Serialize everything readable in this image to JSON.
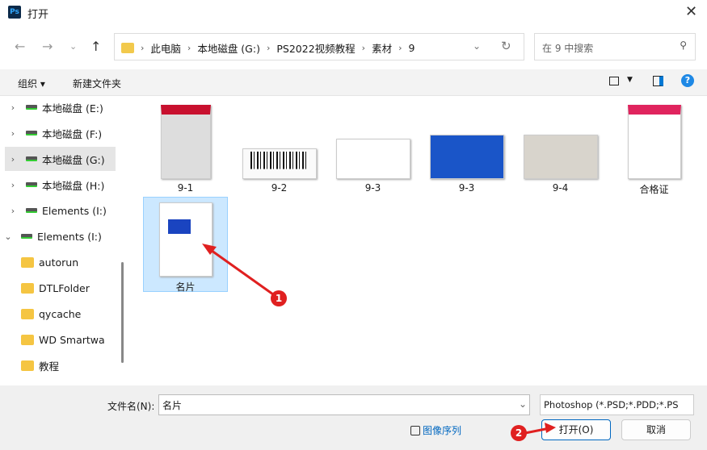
{
  "window": {
    "app_icon": "Ps",
    "title": "打开"
  },
  "address": {
    "crumbs": [
      "此电脑",
      "本地磁盘 (G:)",
      "PS2022视频教程",
      "素材",
      "9"
    ]
  },
  "search": {
    "placeholder": "在 9 中搜索"
  },
  "toolbar": {
    "organize": "组织 ▾",
    "new_folder": "新建文件夹"
  },
  "sidebar": {
    "items": [
      {
        "label": "本地磁盘 (E:)",
        "type": "drive"
      },
      {
        "label": "本地磁盘 (F:)",
        "type": "drive"
      },
      {
        "label": "本地磁盘 (G:)",
        "type": "drive",
        "selected": true
      },
      {
        "label": "本地磁盘 (H:)",
        "type": "drive"
      },
      {
        "label": "Elements (I:)",
        "type": "drive"
      },
      {
        "label": "Elements (I:)",
        "type": "drive",
        "expanded": true
      },
      {
        "label": "autorun",
        "type": "folder"
      },
      {
        "label": "DTLFolder",
        "type": "folder"
      },
      {
        "label": "qycache",
        "type": "folder"
      },
      {
        "label": "WD Smartwa",
        "type": "folder"
      },
      {
        "label": "教程",
        "type": "folder"
      }
    ]
  },
  "files": [
    {
      "name": "9-1"
    },
    {
      "name": "9-2"
    },
    {
      "name": "9-3"
    },
    {
      "name": "9-3"
    },
    {
      "name": "9-4"
    },
    {
      "name": "合格证"
    },
    {
      "name": "名片",
      "selected": true
    }
  ],
  "bottom": {
    "filename_label": "文件名(N):",
    "filename_value": "名片",
    "filetype": "Photoshop (*.PSD;*.PDD;*.PS",
    "image_sequence": "图像序列",
    "open": "打开(O)",
    "cancel": "取消"
  },
  "annotations": {
    "badge1": "1",
    "badge2": "2",
    "color": "#e02020"
  }
}
